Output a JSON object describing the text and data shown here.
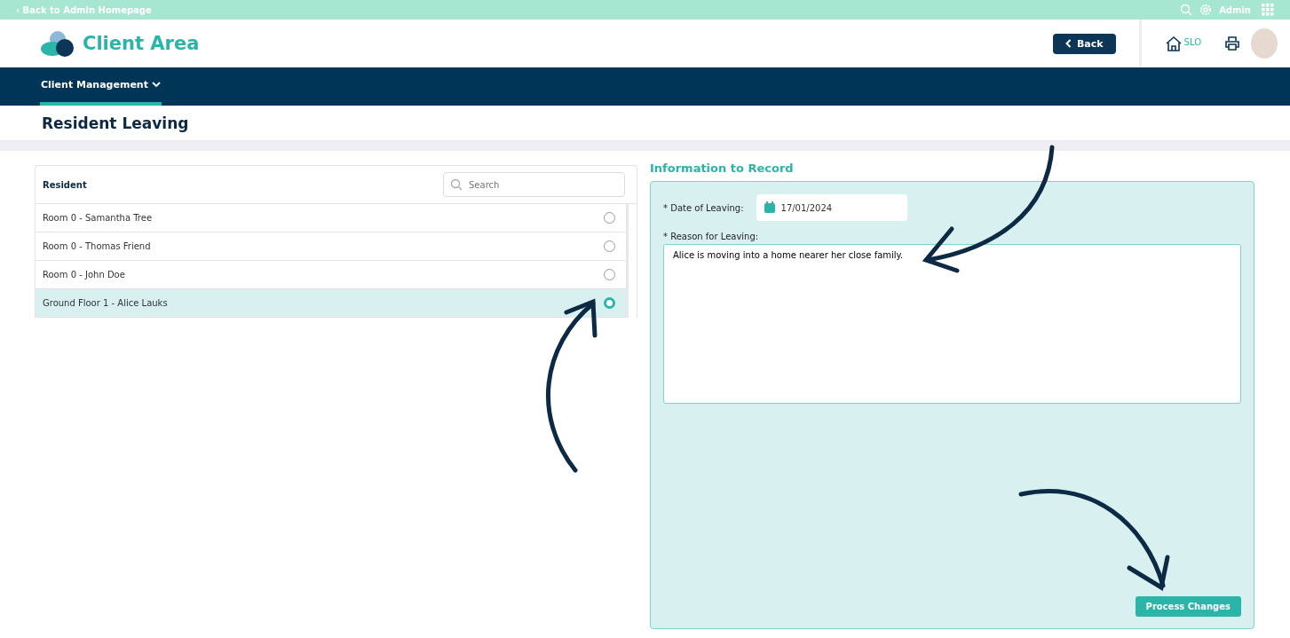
{
  "top_bar": {
    "back_link": "‹ Back to Admin Homepage",
    "user": "Admin"
  },
  "header": {
    "title": "Client Area",
    "back_button": "Back",
    "home_label": "SLO"
  },
  "nav": {
    "items": [
      {
        "label": "Client Management",
        "selected": true
      }
    ]
  },
  "page_title": "Resident Leaving",
  "resident_list": {
    "column": "Resident",
    "search": {
      "placeholder": "Search"
    },
    "rows": [
      {
        "label": "Room 0 - Samantha Tree",
        "selected": false
      },
      {
        "label": "Room 0 - Thomas Friend",
        "selected": false
      },
      {
        "label": "Room 0 - John Doe",
        "selected": false
      },
      {
        "label": "Ground Floor 1 - Alice Lauks",
        "selected": true
      }
    ]
  },
  "form": {
    "title": "Information to Record",
    "date_label": "* Date of Leaving:",
    "date_value": "17/01/2024",
    "reason_label": "* Reason for Leaving:",
    "reason_value": "Alice is moving into a home nearer her close family.",
    "submit": "Process Changes"
  }
}
